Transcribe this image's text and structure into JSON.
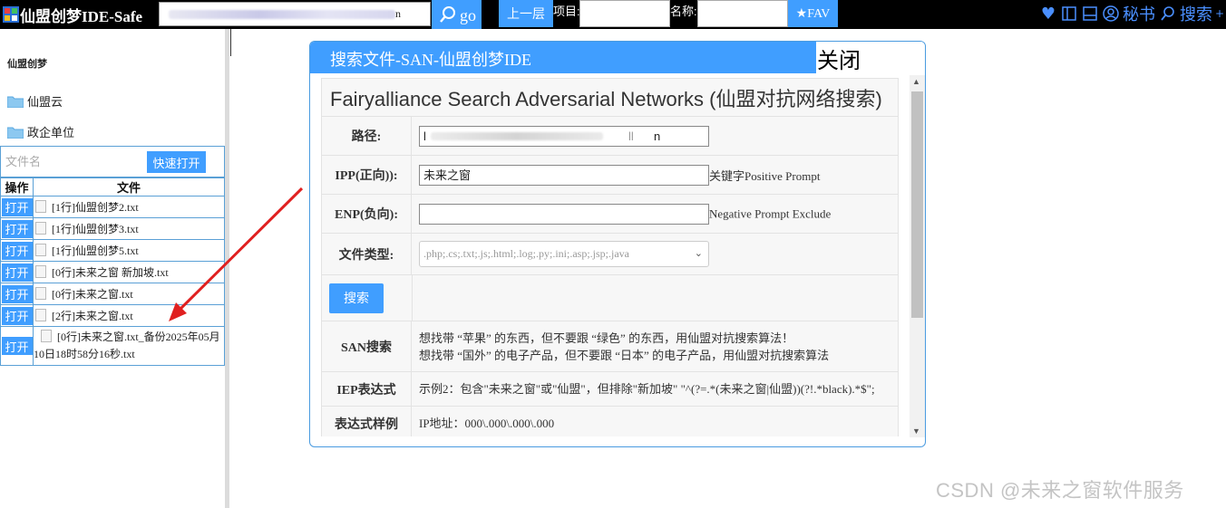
{
  "topbar": {
    "app_title": "仙盟创梦IDE-Safe",
    "path_value_tail": "n",
    "go_label": "go",
    "up_label": "上一层",
    "project_label": "项目:",
    "project_value": "",
    "name_label": "名称:",
    "name_value": "",
    "fav_label": "★FAV",
    "secretary_label": "秘书",
    "search_label": "搜索"
  },
  "sidebar": {
    "category": "仙盟创梦",
    "folders": [
      "仙盟云",
      "政企单位"
    ],
    "filename_placeholder": "文件名",
    "quick_open_label": "快速打开",
    "table_headers": [
      "操作",
      "文件"
    ],
    "open_label": "打开",
    "files": [
      "[1行]仙盟创梦2.txt",
      "[1行]仙盟创梦3.txt",
      "[1行]仙盟创梦5.txt",
      "[0行]未来之窗 新加坡.txt",
      "[0行]未来之窗.txt",
      "[2行]未来之窗.txt",
      "[0行]未来之窗.txt_备份2025年05月10日18时58分16秒.txt"
    ]
  },
  "dialog": {
    "title": "搜索文件-SAN-仙盟创梦IDE",
    "close_label": "关闭",
    "heading": "Fairyalliance Search Adversarial Networks (仙盟对抗网络搜索)",
    "path_label": "路径:",
    "path_value_start": "l",
    "path_value_mid": "ll",
    "path_value_end": "n",
    "ipp_label": "IPP(正向)):",
    "ipp_value": "未来之窗",
    "ipp_hint": "关键字Positive Prompt",
    "enp_label": "ENP(负向):",
    "enp_value": "",
    "enp_hint": "Negative Prompt Exclude",
    "filetype_label": "文件类型:",
    "filetype_value": ".php;.cs;.txt;.js;.html;.log;.py;.ini;.asp;.jsp;.java",
    "search_label": "搜索",
    "san_label": "SAN搜索",
    "san_desc_1": "想找带 “苹果” 的东西，但不要跟 “绿色” 的东西，用仙盟对抗搜索算法！",
    "san_desc_2": "想找带 “国外” 的电子产品，但不要跟 “日本” 的电子产品，用仙盟对抗搜索算法",
    "iep_label": "IEP表达式",
    "iep_desc": "示例2：包含\"未来之窗\"或\"仙盟\"，但排除\"新加坡\" \"^(?=.*(未来之窗|仙盟))(?!.*black).*$\";",
    "regex_label": "表达式样例",
    "regex_desc": "IP地址：000\\.000\\.000\\.000"
  },
  "watermark": "CSDN @未来之窗软件服务",
  "colors": {
    "accent": "#409eff",
    "topbar_bg": "#000000",
    "border": "#5aa0d6",
    "arrow": "#e02020"
  }
}
